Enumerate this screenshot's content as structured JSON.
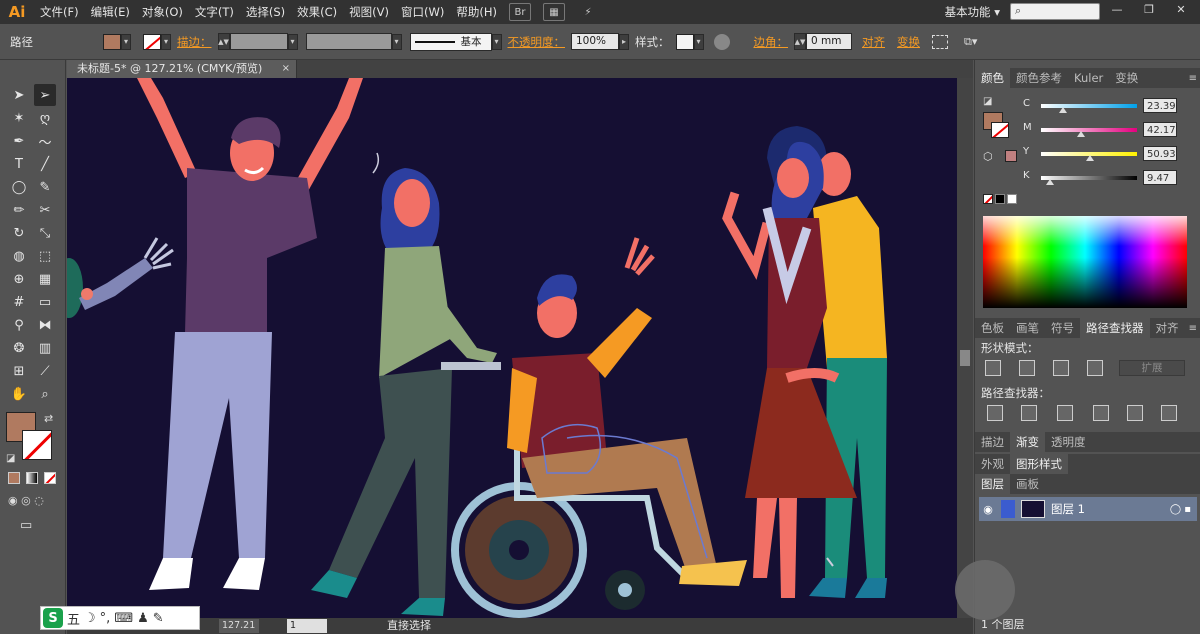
{
  "app": {
    "logo": "Ai"
  },
  "menu": [
    "文件(F)",
    "编辑(E)",
    "对象(O)",
    "文字(T)",
    "选择(S)",
    "效果(C)",
    "视图(V)",
    "窗口(W)",
    "帮助(H)"
  ],
  "topbar": {
    "workspace": "基本功能 ▾",
    "search_placeholder": ""
  },
  "control": {
    "object_type": "路径",
    "fill_color": "#b07a60",
    "stroke_link": "描边：",
    "stroke_style": "基本",
    "opacity_link": "不透明度：",
    "opacity_value": "100%",
    "style_label": "样式：",
    "corner_link": "边角：",
    "corner_value": "0 mm",
    "align_link": "对齐",
    "transform_link": "变换"
  },
  "document": {
    "tab_title": "未标题-5* @ 127.21% (CMYK/预览)",
    "close": "×"
  },
  "status": {
    "zoom": "127.21",
    "page": "1",
    "tool": "直接选择"
  },
  "ime": {
    "logo": "S",
    "mode": "五",
    "items": [
      "☽",
      "°,",
      "⌨",
      "♟",
      "✎"
    ]
  },
  "color_panel": {
    "tabs": [
      "颜色",
      "颜色参考",
      "Kuler",
      "变换"
    ],
    "sliders": [
      {
        "label": "C",
        "value": "23.39",
        "pos": 0.23,
        "gradient": "linear-gradient(to right,#fff,#00a0e9)"
      },
      {
        "label": "M",
        "value": "42.17",
        "pos": 0.42,
        "gradient": "linear-gradient(to right,#fff,#e4007f)"
      },
      {
        "label": "Y",
        "value": "50.93",
        "pos": 0.51,
        "gradient": "linear-gradient(to right,#fff,#fff100)"
      },
      {
        "label": "K",
        "value": "9.47",
        "pos": 0.09,
        "gradient": "linear-gradient(to right,#fff,#000)"
      }
    ]
  },
  "pathfinder_panel": {
    "tabs": [
      "色板",
      "画笔",
      "符号",
      "路径查找器",
      "对齐"
    ],
    "shape_modes_label": "形状模式：",
    "pathfinders_label": "路径查找器：",
    "expand_label": "扩展"
  },
  "gradient_panel": {
    "tabs": [
      "描边",
      "渐变",
      "透明度"
    ]
  },
  "appearance_panel": {
    "tabs": [
      "外观",
      "图形样式"
    ]
  },
  "layers_panel": {
    "tabs": [
      "图层",
      "画板"
    ],
    "layer_name": "图层 1",
    "layer_count": "1 个图层"
  },
  "tools": [
    "selection-tool",
    "direct-selection-tool",
    "magic-wand-tool",
    "lasso-tool",
    "pen-tool",
    "curvature-tool",
    "type-tool",
    "line-tool",
    "ellipse-tool",
    "paintbrush-tool",
    "pencil-tool",
    "scissors-tool",
    "rotate-tool",
    "scale-tool",
    "warp-tool",
    "free-transform-tool",
    "shape-builder-tool",
    "perspective-grid-tool",
    "mesh-tool",
    "gradient-tool",
    "eyedropper-tool",
    "blend-tool",
    "symbol-sprayer-tool",
    "column-graph-tool",
    "artboard-tool",
    "slice-tool",
    "hand-tool",
    "zoom-tool"
  ]
}
